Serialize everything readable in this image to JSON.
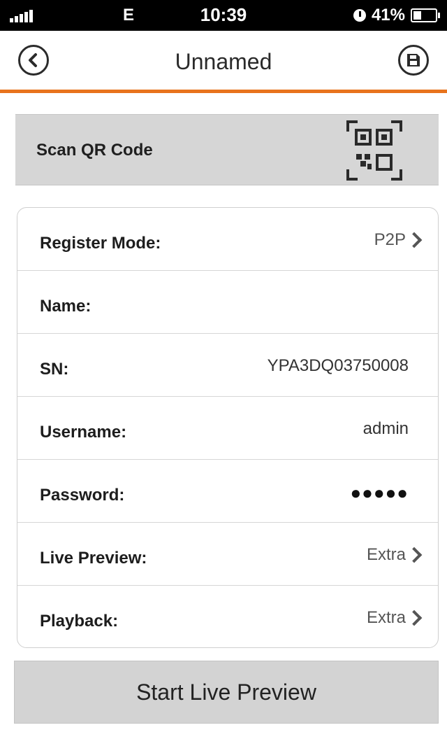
{
  "status_bar": {
    "carrier": "E",
    "time": "10:39",
    "battery_percent": "41%",
    "battery_level": 0.41
  },
  "nav": {
    "title": "Unnamed",
    "back_icon": "chevron-left-icon",
    "save_icon": "save-icon",
    "accent_color": "#e8731c"
  },
  "scan": {
    "label": "Scan QR Code",
    "icon": "qr-code-icon"
  },
  "form": {
    "rows": [
      {
        "label": "Register Mode:",
        "value": "P2P",
        "chevron": true
      },
      {
        "label": "Name:",
        "value": "",
        "chevron": false
      },
      {
        "label": "SN:",
        "value": "YPA3DQ03750008",
        "chevron": false
      },
      {
        "label": "Username:",
        "value": "admin",
        "chevron": false
      },
      {
        "label": "Password:",
        "value": "●●●●●",
        "chevron": false
      },
      {
        "label": "Live Preview:",
        "value": "Extra",
        "chevron": true
      },
      {
        "label": "Playback:",
        "value": "Extra",
        "chevron": true
      }
    ]
  },
  "actions": {
    "start_live_preview": "Start Live Preview"
  }
}
